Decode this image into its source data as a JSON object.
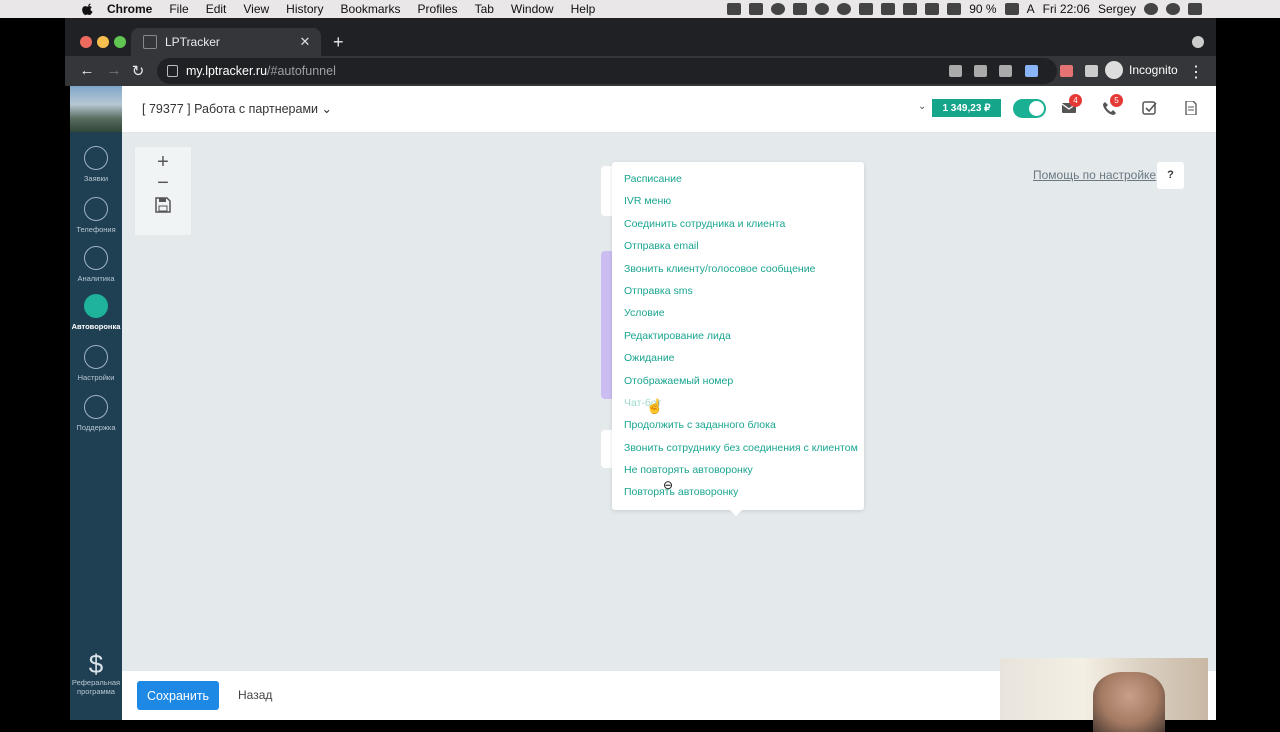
{
  "menubar": {
    "apple": "",
    "items": [
      "Chrome",
      "File",
      "Edit",
      "View",
      "History",
      "Bookmarks",
      "Profiles",
      "Tab",
      "Window",
      "Help"
    ],
    "battery": "90 %",
    "input_source": "A",
    "clock": "Fri 22:06",
    "user": "Sergey"
  },
  "browser": {
    "tab_title": "LPTracker",
    "url_host": "my.lptracker.ru",
    "url_path": "/#autofunnel",
    "profile_label": "Incognito"
  },
  "sidebar": {
    "items": [
      {
        "label": "Заявки",
        "icon": "requests-icon"
      },
      {
        "label": "Телефония",
        "icon": "phone-icon"
      },
      {
        "label": "Аналитика",
        "icon": "analytics-icon"
      },
      {
        "label": "Автоворонка",
        "icon": "autofunnel-icon",
        "active": true
      },
      {
        "label": "Настройки",
        "icon": "settings-icon"
      },
      {
        "label": "Поддержка",
        "icon": "support-icon"
      }
    ],
    "referral": {
      "label_line1": "Реферальная",
      "label_line2": "программа",
      "icon": "dollar-icon"
    }
  },
  "header": {
    "project": "[ 79377 ] Работа с партнерами",
    "balance": "1 349,23 ₽",
    "mail_badge": "4",
    "phone_badge": "5"
  },
  "canvas": {
    "help_link": "Помощь по настройке",
    "help_button": "?"
  },
  "dropdown": {
    "items": [
      "Расписание",
      "IVR меню",
      "Соединить сотрудника и клиента",
      "Отправка email",
      "Звонить клиенту/голосовое сообщение",
      "Отправка sms",
      "Условие",
      "Редактирование лида",
      "Ожидание",
      "Отображаемый номер",
      "Чат-бот",
      "Продолжить с заданного блока",
      "Звонить сотруднику без соединения с клиентом",
      "Не повторять автоворонку",
      "Повторять автоворонку"
    ]
  },
  "footer": {
    "save": "Сохранить",
    "back": "Назад"
  },
  "colors": {
    "accent": "#1aa58f",
    "sidebar": "#1f3f53",
    "save_button": "#1e88e5",
    "badge": "#e53935"
  }
}
